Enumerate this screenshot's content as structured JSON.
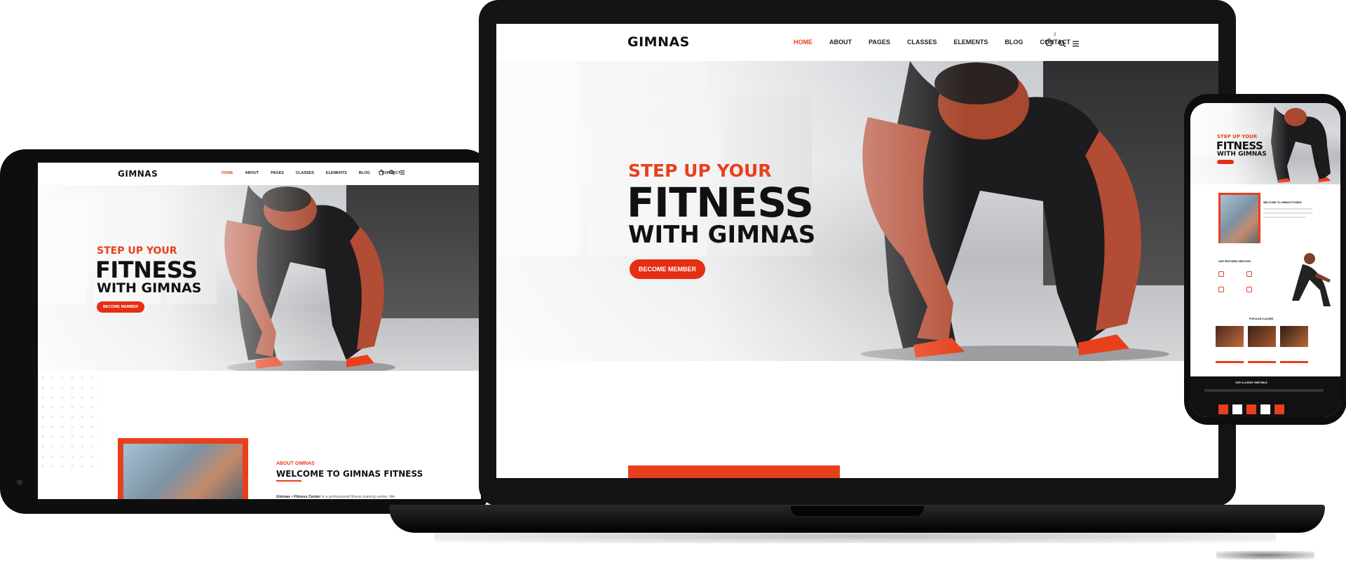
{
  "site": {
    "logo": "GIMNAS",
    "logo_dot": "•",
    "nav": [
      "HOME",
      "ABOUT",
      "PAGES",
      "CLASSES",
      "ELEMENTS",
      "BLOG",
      "CONTACT"
    ],
    "cart_count": "2",
    "hero": {
      "subtitle": "STEP UP YOUR",
      "title": "FITNESS",
      "tail": "WITH GIMNAS",
      "cta": "BECOME MEMBER"
    },
    "about": {
      "label": "ABOUT GIMNAS",
      "title": "WELCOME TO GIMNAS FITNESS",
      "text_bold": "Gimnas • Fitness Center",
      "text": "is a professional fitness training center. We"
    }
  },
  "phone": {
    "hero_sub": "STEP UP YOUR",
    "hero_title": "FITNESS",
    "hero_tail": "WITH GIMNAS",
    "about_title": "WELCOME TO GIMNAS FITNESS",
    "services_title": "OUR FEATURED SERVICES",
    "classes_title": "POPULAR CLASSES",
    "timetable_title": "OUR CLASSES TIMETABLE"
  },
  "colors": {
    "accent": "#e8401c",
    "dark": "#111111"
  },
  "icons": [
    "cart-icon",
    "search-icon",
    "menu-icon"
  ]
}
